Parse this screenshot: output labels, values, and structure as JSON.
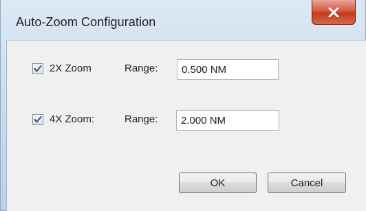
{
  "window": {
    "title": "Auto-Zoom Configuration",
    "close_icon": "close-icon"
  },
  "options": [
    {
      "label": "2X Zoom",
      "checked": true,
      "range_label": "Range:",
      "range_value": "0.500 NM"
    },
    {
      "label": "4X Zoom:",
      "checked": true,
      "range_label": "Range:",
      "range_value": "2.000 NM"
    }
  ],
  "buttons": {
    "ok_label": "OK",
    "cancel_label": "Cancel"
  },
  "colors": {
    "close_button": "#c23a1f",
    "client_background": "#f0f0f0",
    "title_background": "#dde8f4",
    "checkmark": "#3c5a8a"
  }
}
